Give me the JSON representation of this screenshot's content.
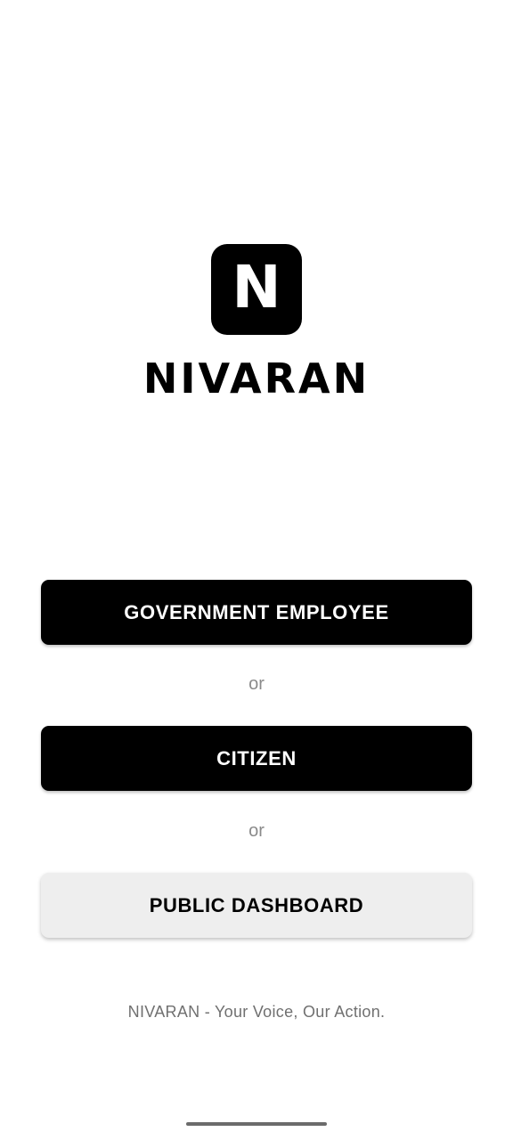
{
  "app": {
    "logo_letter": "N",
    "title": "NIVARAN"
  },
  "buttons": {
    "government_employee": "GOVERNMENT EMPLOYEE",
    "citizen": "CITIZEN",
    "public_dashboard": "PUBLIC DASHBOARD"
  },
  "separators": {
    "first": "or",
    "second": "or"
  },
  "footer": {
    "tagline": "NIVARAN - Your Voice, Our Action."
  },
  "colors": {
    "primary": "#000000",
    "secondary_button": "#eeeeee",
    "muted_text": "#8a8a8a"
  }
}
